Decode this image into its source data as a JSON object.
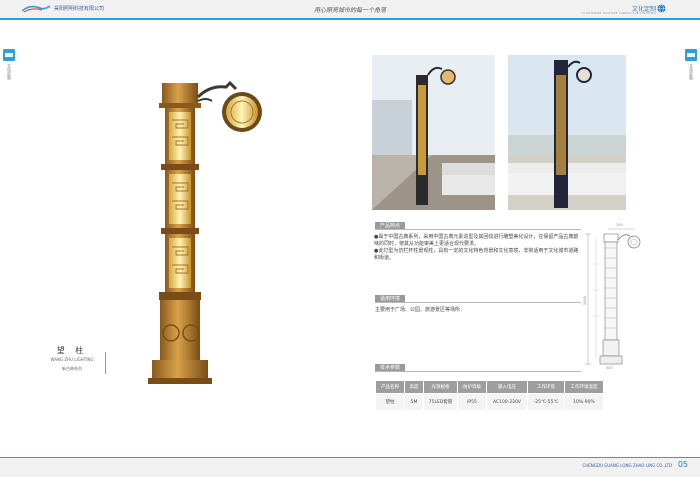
{
  "header": {
    "company": "昊阳照明科技有限公司",
    "slogan": "用心照亮城市的每一个角落",
    "section_title": "文化定制",
    "section_subtitle": "CUSTOMIZE CULTURE LANDSCAPE LIGHTING",
    "accent_color": "#2ba2d6"
  },
  "side": {
    "left_label": "文化定制",
    "right_label": "文化定制"
  },
  "product": {
    "name_cn": "望 柱",
    "name_en": "WANG ZHU LIGHTING",
    "series": "新古典系列"
  },
  "features": {
    "heading": "产品特点",
    "items": [
      "●属于中国古典系列，采用中国古典元素造型及其回纹进行雕塑美化设计，在保留产品古典韵味的同时，使其从功能审美上更适合现代要求。",
      "●此灯型为仿栏杆柱景观柱，具有一定的文化特色背景和文化意境，非常适用于文化城市道路和街道。"
    ]
  },
  "usage": {
    "heading": "适用环境",
    "text": "主要用于广场、公园、旅游景区等场所："
  },
  "params": {
    "heading": "技术参数",
    "headers": [
      "产品名称",
      "高度",
      "光源规格",
      "防护等级",
      "输入电压",
      "工作环境",
      "工作环境湿度"
    ],
    "rows": [
      [
        "望柱",
        "5M",
        "75LED套管",
        "IP55",
        "AC100-220V",
        "-25℃-55℃",
        "10%-90%"
      ]
    ]
  },
  "diagram": {
    "dims": [
      "200",
      "5000",
      "500"
    ]
  },
  "footer": {
    "text": "CHENGDU GUANG LONG ZHAO LING CO.,LTD",
    "page": "05"
  }
}
